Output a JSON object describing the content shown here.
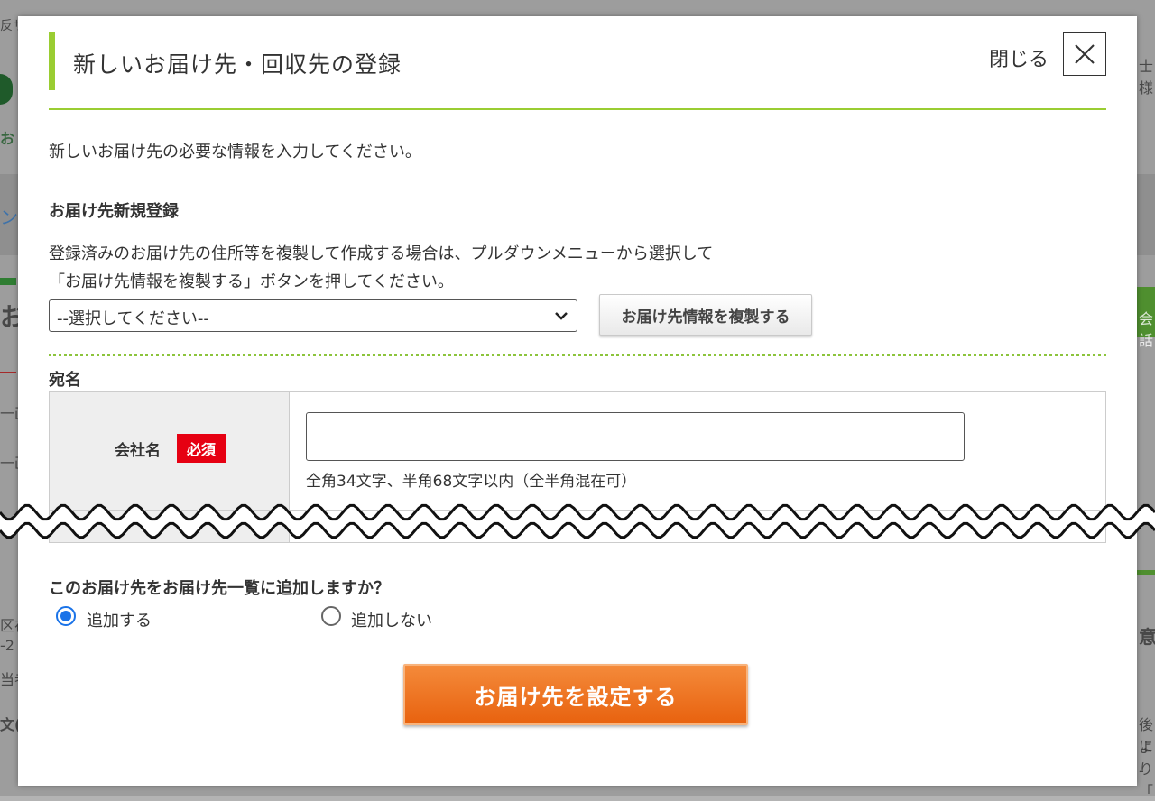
{
  "background": {
    "fragments": [
      "反サ",
      "お",
      "ン",
      "お",
      "一画",
      "一画",
      "区在",
      "-2",
      "当者",
      "文(",
      "士",
      "様",
      "会話",
      "意",
      "後に",
      "より",
      "-「"
    ]
  },
  "modal": {
    "title": "新しいお届け先・回収先の登録",
    "close_label": "閉じる",
    "close_icon": "close-icon",
    "intro": "新しいお届け先の必要な情報を入力してください。",
    "section_heading": "お届け先新規登録",
    "duplicate_instruction_1": "登録済みのお届け先の住所等を複製して作成する場合は、プルダウンメニューから選択して",
    "duplicate_instruction_2": "「お届け先情報を複製する」ボタンを押してください。",
    "select_value": "--選択してください--",
    "duplicate_button": "お届け先情報を複製する",
    "addressee_label": "宛名",
    "company_label": "会社名",
    "required_badge": "必須",
    "company_value": "",
    "company_hint": "全角34文字、半角68文字以内（全半角混在可）",
    "add_question": "このお届け先をお届け先一覧に追加しますか？",
    "radio_add": "追加する",
    "radio_noadd": "追加しない",
    "radio_selected": "追加する",
    "submit_button": "お届け先を設定する"
  },
  "colors": {
    "accent_green": "#9acd32",
    "required_red": "#e60012",
    "submit_orange": "#ee7020",
    "radio_blue": "#1a73e8"
  }
}
